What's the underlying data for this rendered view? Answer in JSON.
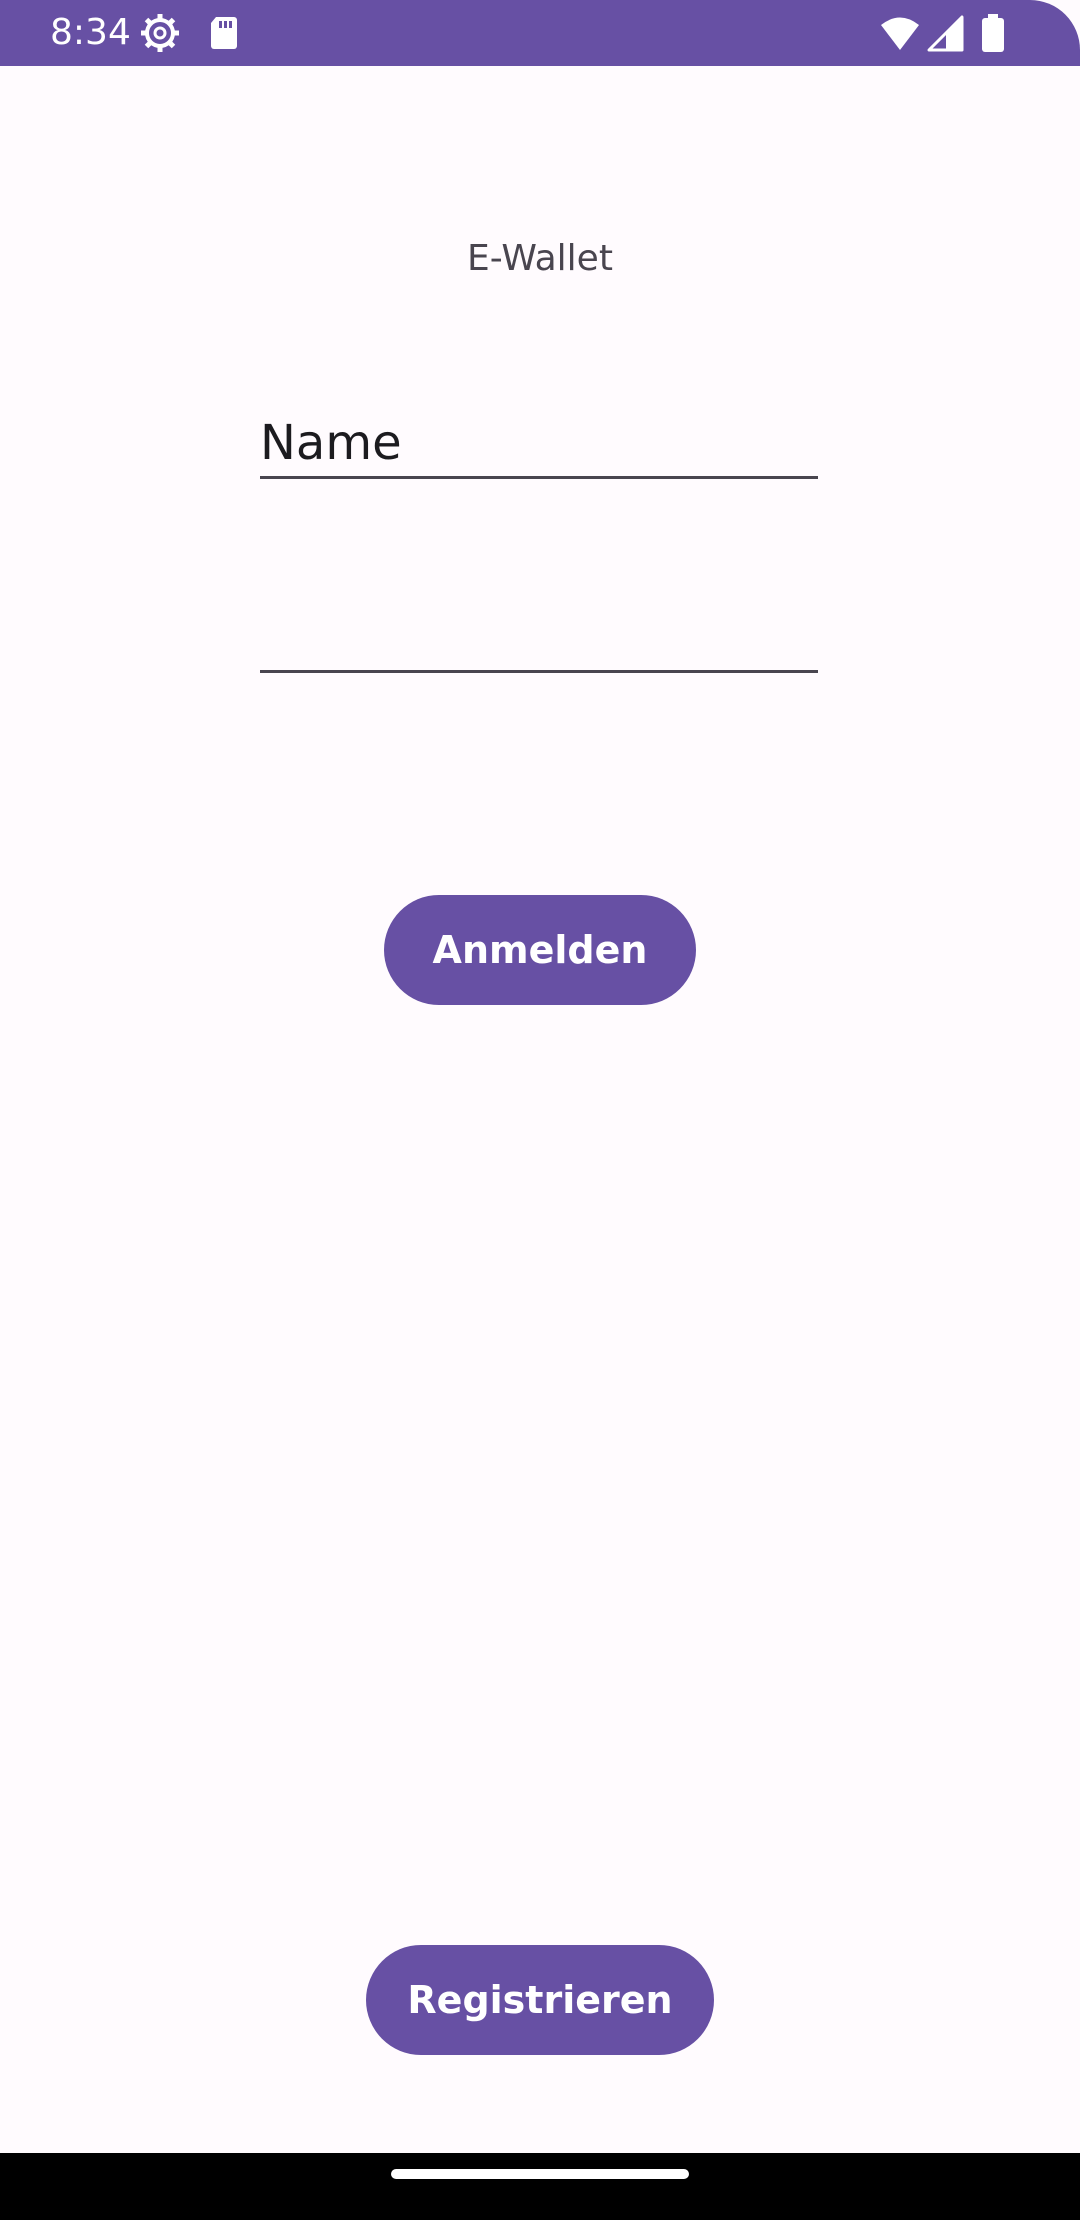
{
  "status_bar": {
    "time": "8:34",
    "icons": [
      "settings-gear-icon",
      "sd-card-icon",
      "wifi-icon",
      "cell-signal-icon",
      "battery-icon"
    ],
    "color": "#6750A4"
  },
  "app": {
    "title": "E-Wallet"
  },
  "form": {
    "name_placeholder": "Name",
    "name_value": "",
    "password_value": ""
  },
  "buttons": {
    "login_label": "Anmelden",
    "register_label": "Registrieren"
  },
  "colors": {
    "primary": "#6750A4",
    "background": "#FFFBFE",
    "text": "#1C1B1F",
    "title_text": "#49454F"
  }
}
